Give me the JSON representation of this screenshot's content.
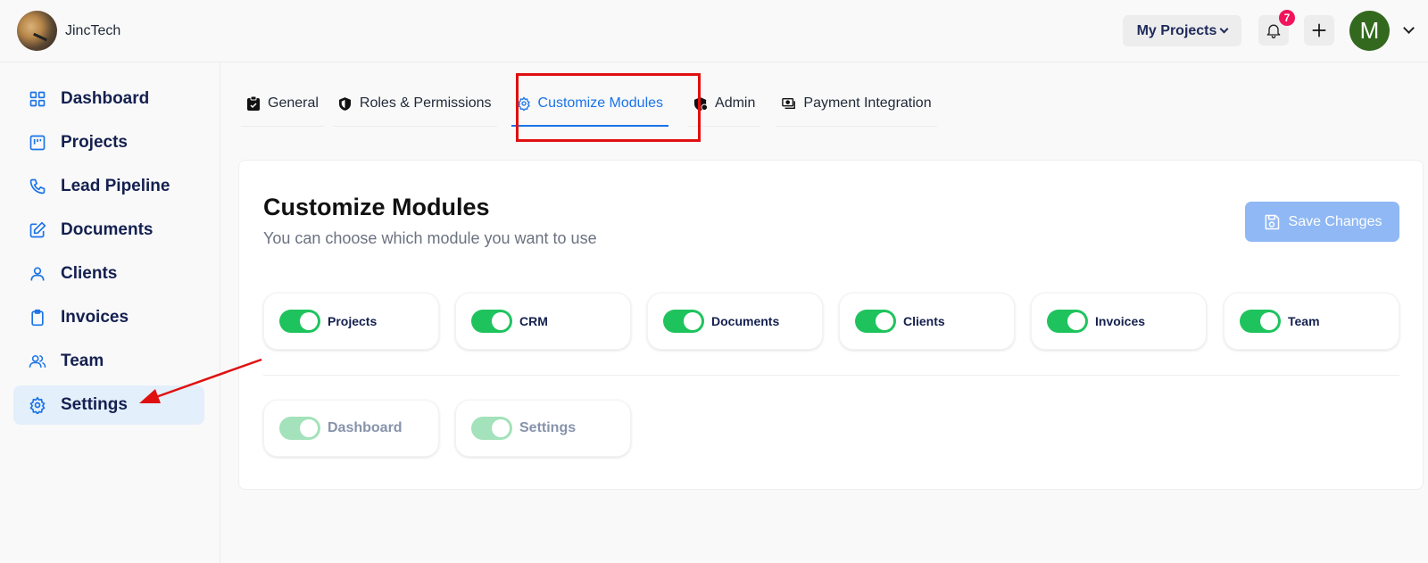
{
  "header": {
    "brand_name": "JincTech",
    "projects_dropdown": "My Projects",
    "notification_count": "7",
    "user_initial": "M"
  },
  "sidebar": {
    "items": [
      {
        "label": "Dashboard",
        "icon": "grid-icon"
      },
      {
        "label": "Projects",
        "icon": "kanban-icon"
      },
      {
        "label": "Lead Pipeline",
        "icon": "phone-icon"
      },
      {
        "label": "Documents",
        "icon": "edit-icon"
      },
      {
        "label": "Clients",
        "icon": "user-icon"
      },
      {
        "label": "Invoices",
        "icon": "clipboard-icon"
      },
      {
        "label": "Team",
        "icon": "users-icon"
      },
      {
        "label": "Settings",
        "icon": "gear-icon",
        "active": true
      }
    ]
  },
  "tabs": [
    {
      "label": "General",
      "icon": "clipboard-check-icon"
    },
    {
      "label": "Roles & Permissions",
      "icon": "shield-icon"
    },
    {
      "label": "Customize Modules",
      "icon": "gear-icon",
      "active": true
    },
    {
      "label": "Admin",
      "icon": "shield-user-icon"
    },
    {
      "label": "Payment Integration",
      "icon": "money-icon"
    }
  ],
  "panel": {
    "title": "Customize Modules",
    "subtitle": "You can choose which module you want to use",
    "save_label": "Save Changes"
  },
  "modules": {
    "optional": [
      {
        "label": "Projects",
        "enabled": true
      },
      {
        "label": "CRM",
        "enabled": true
      },
      {
        "label": "Documents",
        "enabled": true
      },
      {
        "label": "Clients",
        "enabled": true
      },
      {
        "label": "Invoices",
        "enabled": true
      },
      {
        "label": "Team",
        "enabled": true
      }
    ],
    "required": [
      {
        "label": "Dashboard",
        "enabled": true,
        "locked": true
      },
      {
        "label": "Settings",
        "enabled": true,
        "locked": true
      }
    ]
  },
  "colors": {
    "accent": "#1a73e8",
    "toggle_on": "#1fc35e",
    "toggle_locked": "#a3e2ba",
    "save_disabled": "#8fb8f5",
    "annotation": "#e01010"
  }
}
